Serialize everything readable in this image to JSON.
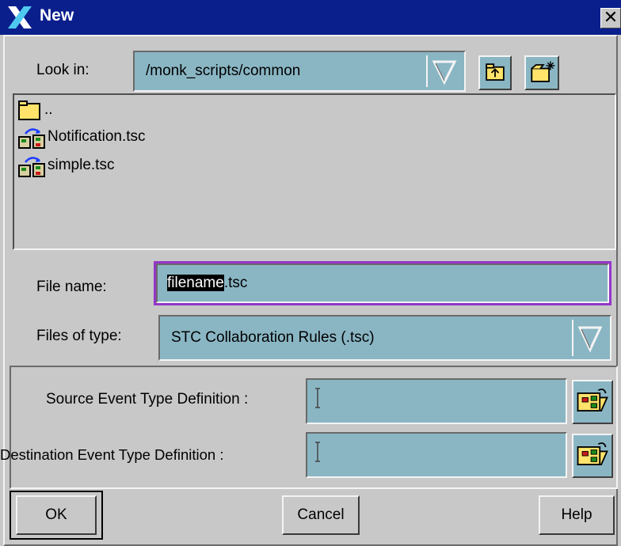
{
  "window": {
    "title": "New",
    "close_glyph": "✕"
  },
  "look_in": {
    "label": "Look in:",
    "value": "/monk_scripts/common"
  },
  "toolbar": {
    "up_folder_icon": "up-one-level-icon",
    "new_folder_icon": "create-new-folder-icon"
  },
  "files": [
    {
      "name": "..",
      "icon": "folder-icon"
    },
    {
      "name": "Notification.tsc",
      "icon": "collaboration-file-icon"
    },
    {
      "name": "simple.tsc",
      "icon": "collaboration-file-icon"
    }
  ],
  "file_name": {
    "label": "File name:",
    "selected_text": "filename",
    "rest_text": ".tsc"
  },
  "files_of_type": {
    "label": "Files of type:",
    "value": "STC Collaboration Rules (.tsc)"
  },
  "source_etd": {
    "label": "Source Event Type Definition :",
    "value": ""
  },
  "destination_etd": {
    "label": "Destination Event Type Definition :",
    "value": ""
  },
  "buttons": {
    "ok": "OK",
    "cancel": "Cancel",
    "help": "Help"
  },
  "colors": {
    "title_bar": "#0b1f8c",
    "field": "#8ab6c4",
    "focus_ring": "#9436c8",
    "dialog": "#c8c8c8"
  }
}
